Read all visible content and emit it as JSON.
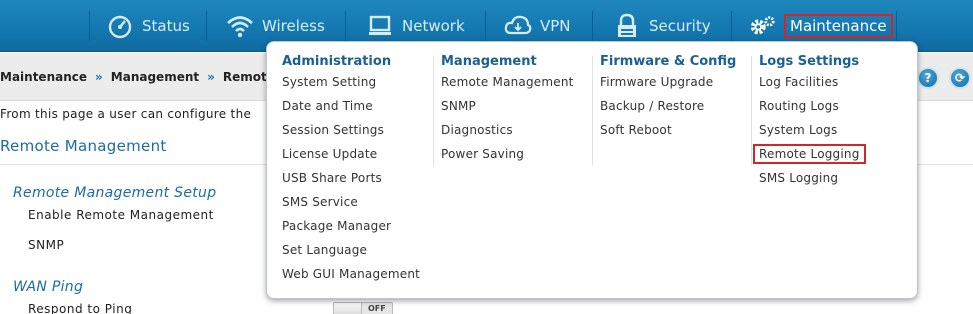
{
  "nav": {
    "items": [
      {
        "label": "Status",
        "icon": "gauge-icon"
      },
      {
        "label": "Wireless",
        "icon": "wifi-icon"
      },
      {
        "label": "Network",
        "icon": "monitor-icon"
      },
      {
        "label": "VPN",
        "icon": "cloud-icon"
      },
      {
        "label": "Security",
        "icon": "lock-icon"
      },
      {
        "label": "Maintenance",
        "icon": "gears-icon"
      }
    ]
  },
  "breadcrumb": {
    "items": [
      "Maintenance",
      "Management",
      "Remote Man"
    ],
    "separator": "»"
  },
  "help_buttons": {
    "help": "?",
    "refresh": "⟳"
  },
  "intro": "From this page a user can configure the",
  "section_title": "Remote Management",
  "form": {
    "setup_heading": "Remote Management Setup",
    "enable_label": "Enable Remote Management",
    "snmp_label": "SNMP",
    "wan_heading": "WAN Ping",
    "respond_label": "Respond to Ping",
    "toggle_state": "OFF"
  },
  "menu": {
    "columns": [
      {
        "heading": "Administration",
        "items": [
          "System Setting",
          "Date and Time",
          "Session Settings",
          "License Update",
          "USB Share Ports",
          "SMS Service",
          "Package Manager",
          "Set Language",
          "Web GUI Management"
        ]
      },
      {
        "heading": "Management",
        "items": [
          "Remote Management",
          "SNMP",
          "Diagnostics",
          "Power Saving"
        ]
      },
      {
        "heading": "Firmware & Config",
        "items": [
          "Firmware Upgrade",
          "Backup / Restore",
          "Soft Reboot"
        ]
      },
      {
        "heading": "Logs Settings",
        "items": [
          "Log Facilities",
          "Routing Logs",
          "System Logs",
          "Remote Logging",
          "SMS Logging"
        ]
      }
    ]
  },
  "colors": {
    "bar": "#1579b1",
    "heading": "#1c5f93",
    "highlight": "#d4262a"
  }
}
